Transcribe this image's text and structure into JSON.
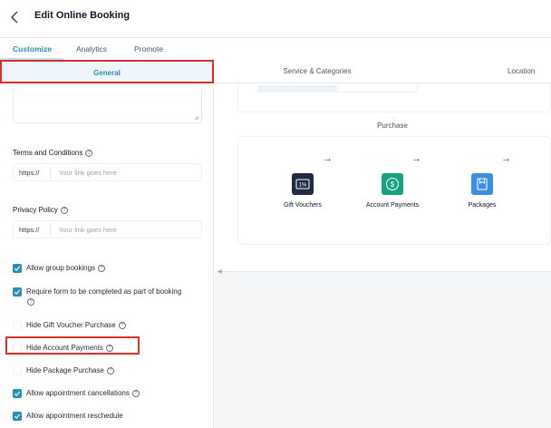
{
  "header": {
    "title": "Edit Online Booking",
    "back_icon": "chevron-left-icon"
  },
  "tabs": [
    {
      "label": "Customize",
      "active": true
    },
    {
      "label": "Analytics",
      "active": false
    },
    {
      "label": "Promote",
      "active": false
    }
  ],
  "subtabs": {
    "general": "General",
    "service": "Service & Categories",
    "location": "Location"
  },
  "form": {
    "terms": {
      "label": "Terms and Conditions",
      "prefix": "https://",
      "placeholder": "Your link goes here"
    },
    "privacy": {
      "label": "Privacy Policy",
      "prefix": "https://",
      "placeholder": "Your link goes here"
    },
    "options": [
      {
        "label": "Allow group bookings",
        "checked": true
      },
      {
        "label": "Require form to be completed as part of booking",
        "checked": true
      },
      {
        "label": "Hide Gift Voucher Purchase",
        "checked": false
      },
      {
        "label": "Hide Account Payments",
        "checked": false
      },
      {
        "label": "Hide Package Purchase",
        "checked": false
      },
      {
        "label": "Allow appointment cancellations",
        "checked": true
      },
      {
        "label": "Allow appointment reschedule",
        "checked": true
      }
    ]
  },
  "purchase": {
    "title": "Purchase",
    "items": [
      {
        "label": "Gift Vouchers",
        "icon": "gift-voucher-icon",
        "color": "#1f2a44"
      },
      {
        "label": "Account Payments",
        "icon": "dollar-icon",
        "color": "#16a37f"
      },
      {
        "label": "Packages",
        "icon": "package-icon",
        "color": "#3b8fe0"
      }
    ]
  },
  "colors": {
    "accent": "#2a8fb3",
    "highlight": "#d9302c"
  }
}
